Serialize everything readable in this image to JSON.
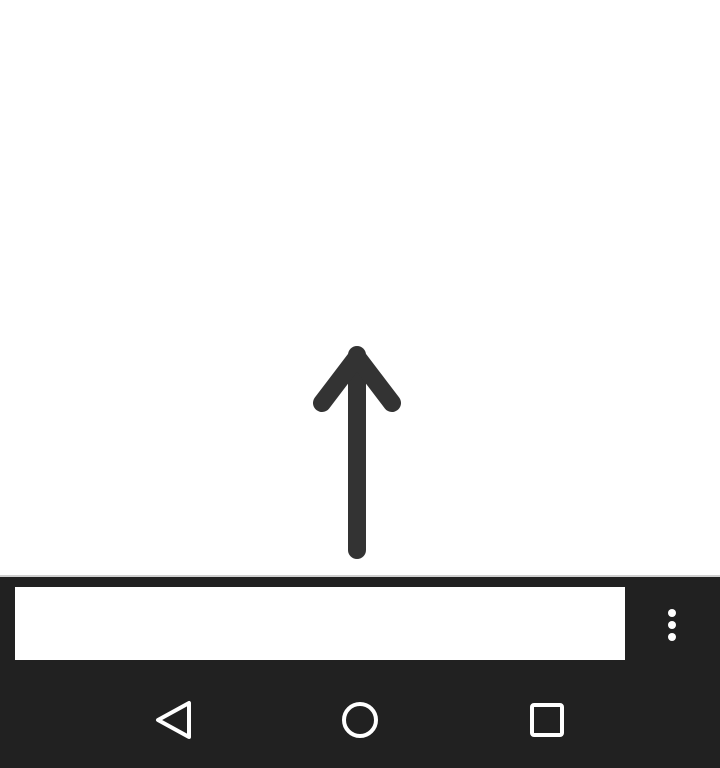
{
  "content": {
    "arrow_icon": "arrow-up-icon",
    "arrow_color": "#333333"
  },
  "input_bar": {
    "input_value": "",
    "input_placeholder": "",
    "menu_icon": "more-vert-icon"
  },
  "navigation": {
    "back_icon": "back-icon",
    "home_icon": "home-icon",
    "recents_icon": "recents-icon"
  },
  "colors": {
    "background": "#ffffff",
    "bar_background": "#212121",
    "icon": "#ffffff"
  }
}
